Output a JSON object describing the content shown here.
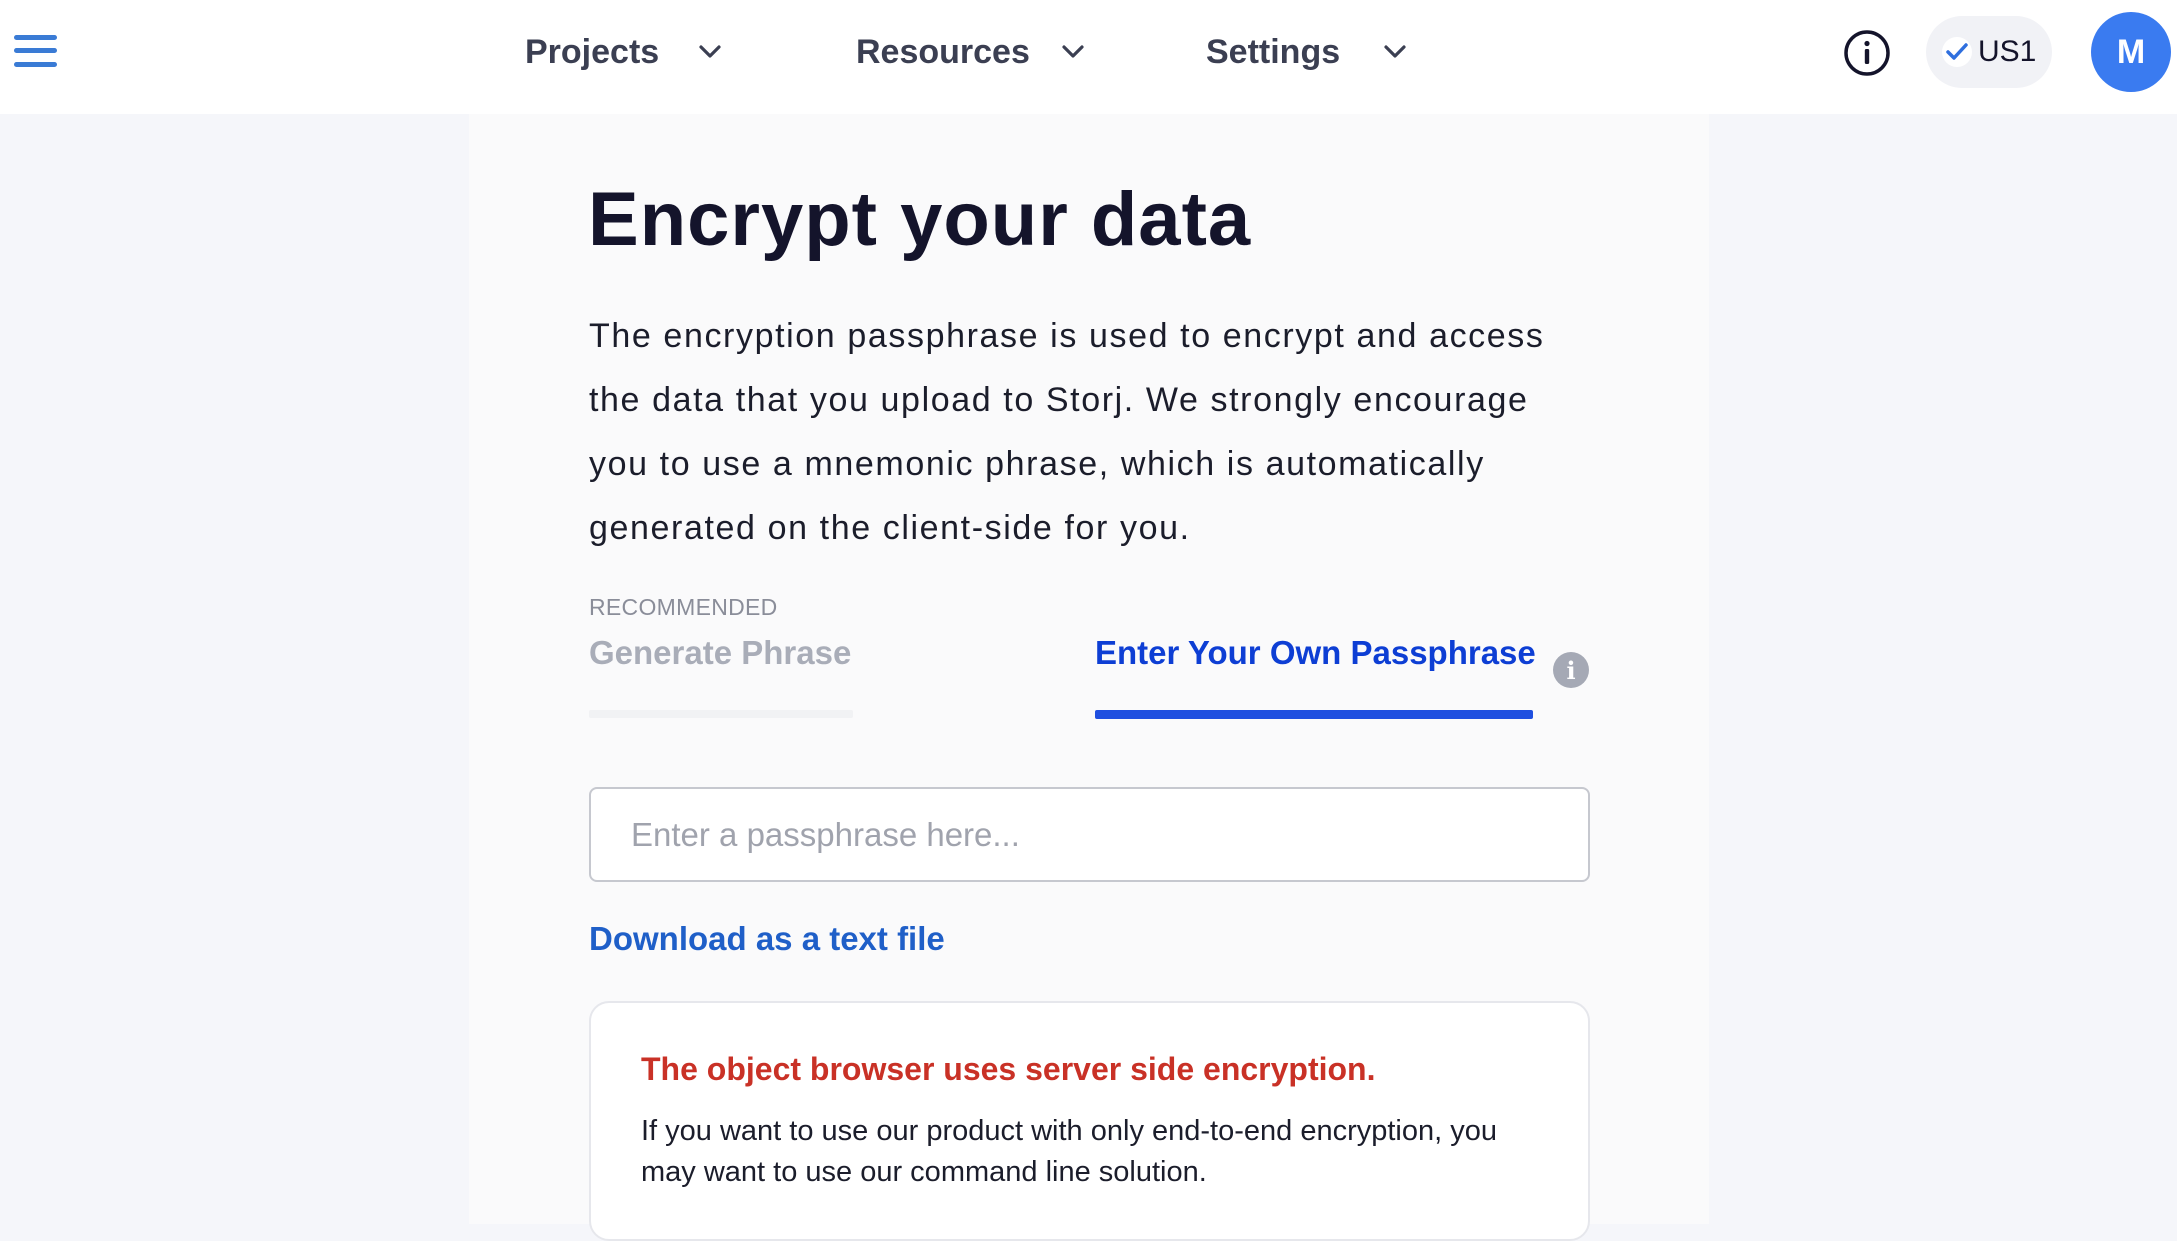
{
  "header": {
    "nav": [
      {
        "label": "Projects"
      },
      {
        "label": "Resources"
      },
      {
        "label": "Settings"
      }
    ],
    "region": "US1",
    "avatar_initial": "M"
  },
  "main": {
    "title": "Encrypt your data",
    "description": "The encryption passphrase is used to encrypt and access the data that you upload to Storj. We strongly encourage you to use a mnemonic phrase, which is automatically generated on the client-side for you.",
    "recommended_label": "RECOMMENDED",
    "tabs": [
      {
        "label": "Generate Phrase",
        "active": false
      },
      {
        "label": "Enter Your Own Passphrase",
        "active": true
      }
    ],
    "tab_info_glyph": "i",
    "passphrase_input": {
      "placeholder": "Enter a passphrase here...",
      "value": ""
    },
    "download_link": "Download as a text file",
    "notice": {
      "title": "The object browser uses server side encryption.",
      "body": "If you want to use our product with only end-to-end encryption, you may want to use our command line solution."
    }
  },
  "colors": {
    "accent_blue": "#1f4fe0",
    "link_blue": "#1f5fc8",
    "avatar_blue": "#3a7bf0",
    "warning_red": "#c93126"
  },
  "icons": [
    "menu-icon",
    "chevron-down-icon",
    "info-icon",
    "checkmark-icon"
  ]
}
